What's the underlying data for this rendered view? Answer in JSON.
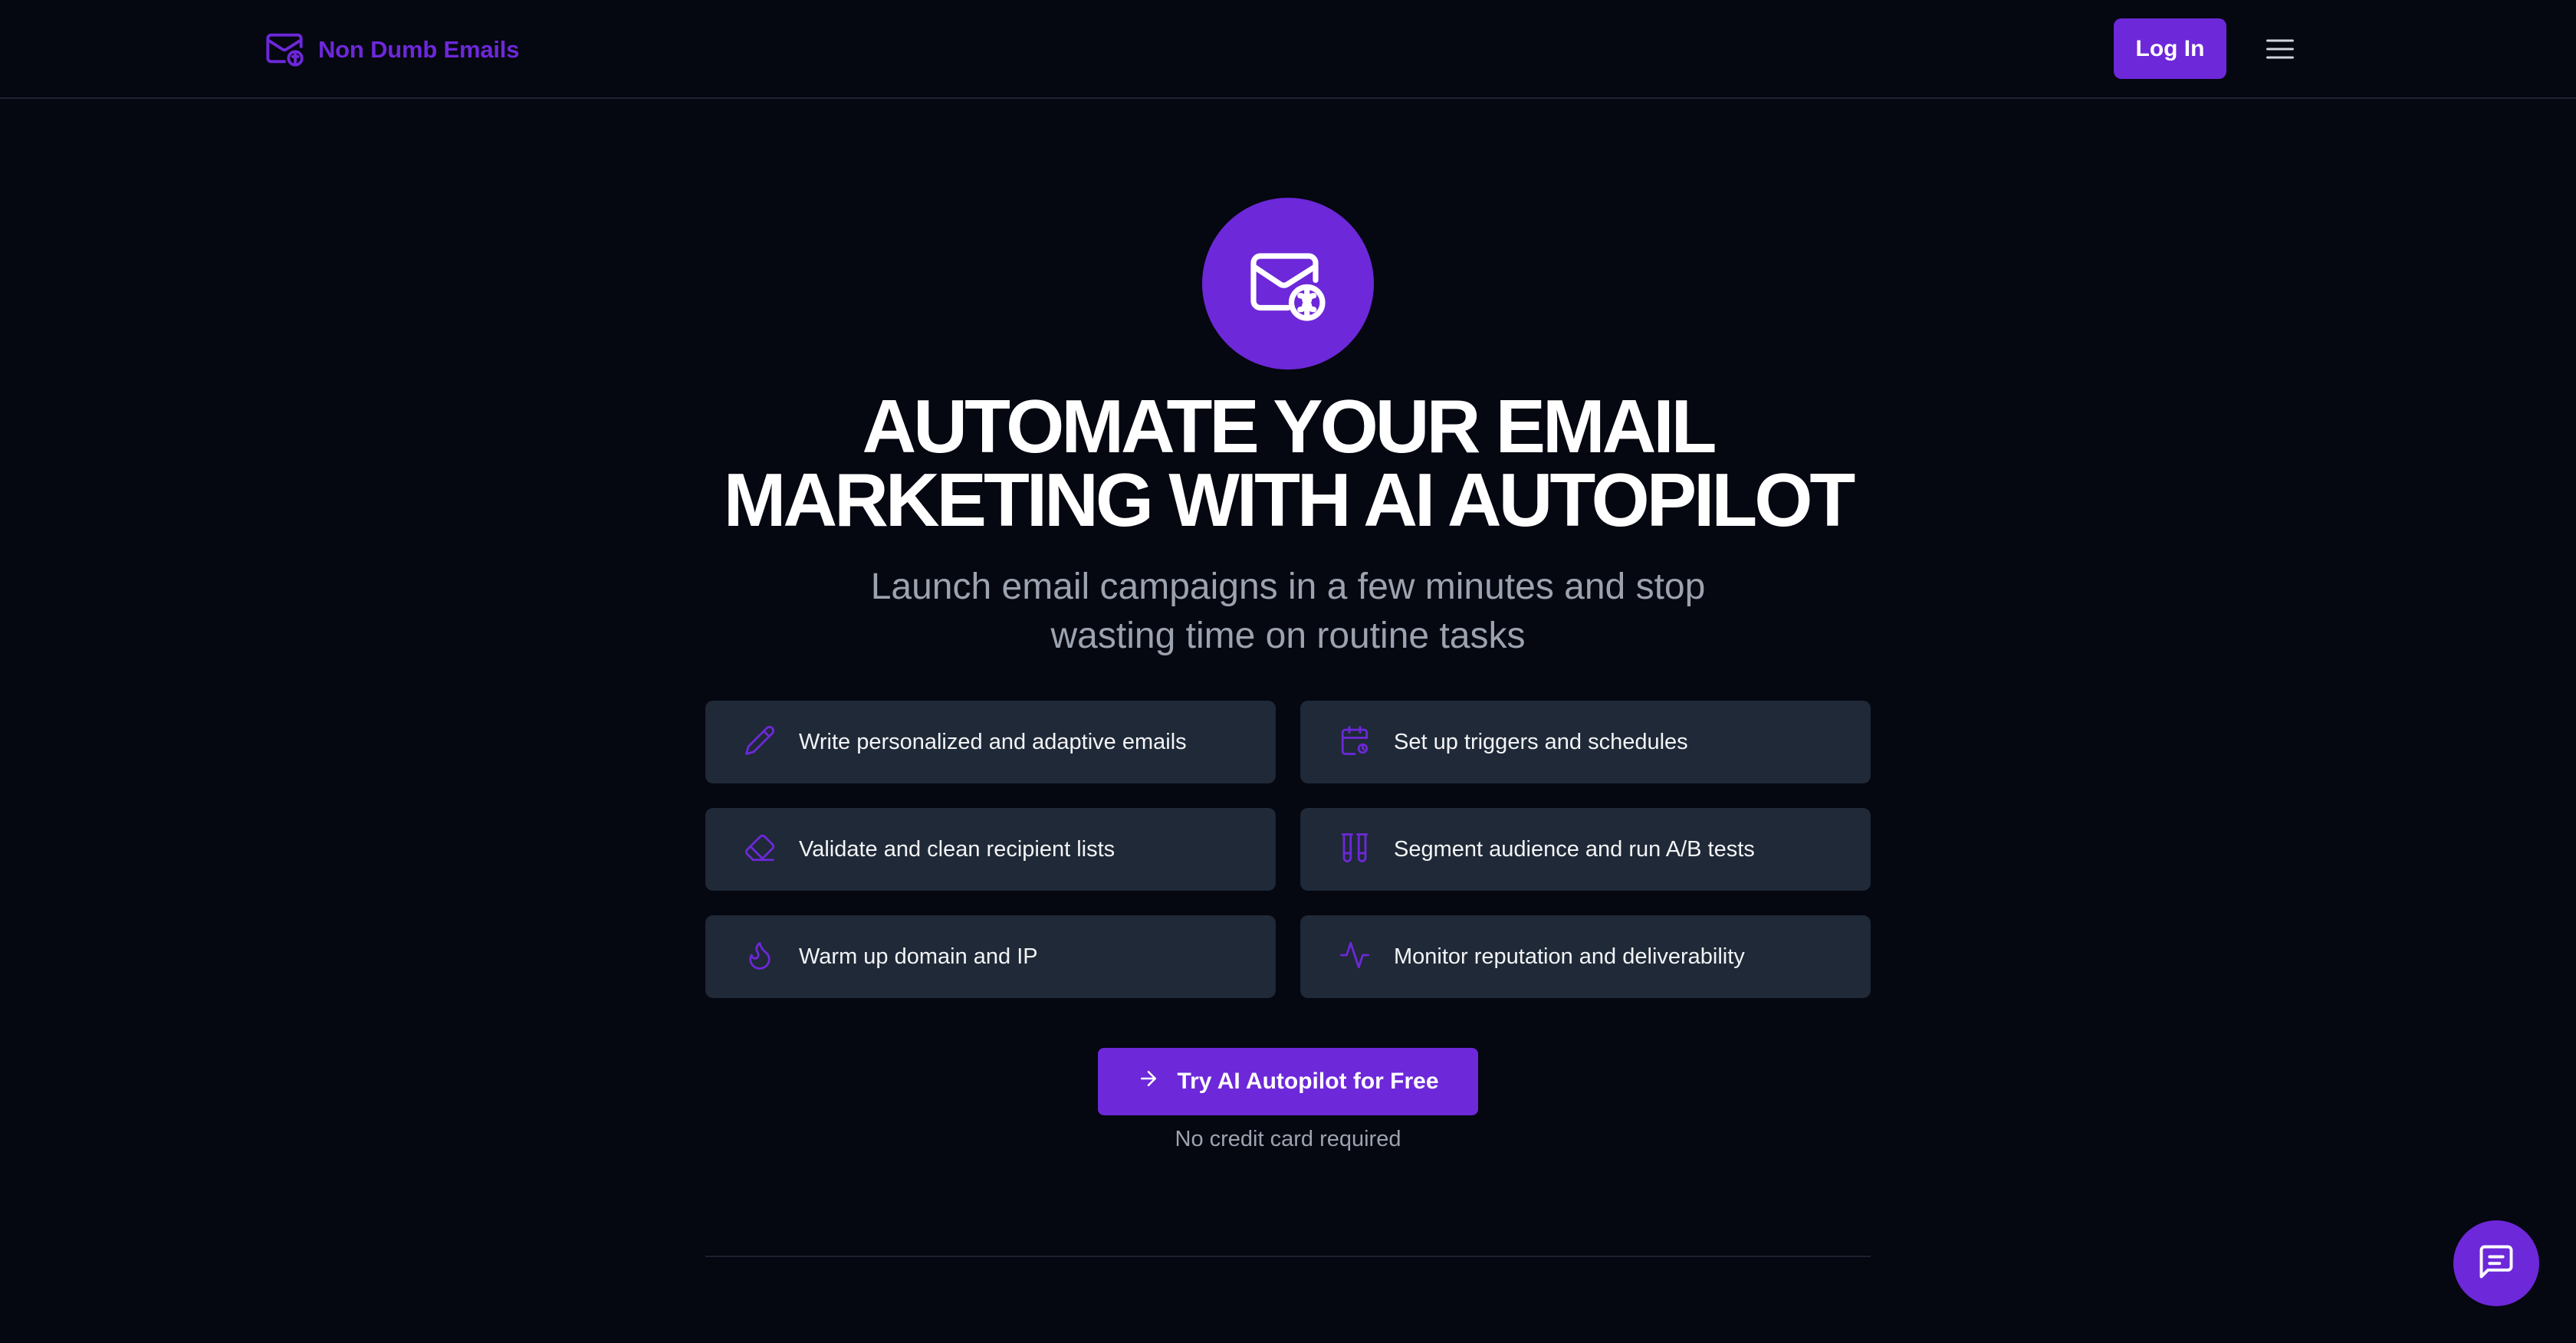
{
  "header": {
    "brand_name": "Non Dumb Emails",
    "brand_icon": "mail-brain-icon",
    "login_label": "Log In",
    "menu_icon": "hamburger-menu-icon"
  },
  "hero": {
    "icon": "mail-brain-icon",
    "title_line1": "AUTOMATE YOUR EMAIL",
    "title_line2": "MARKETING WITH AI AUTOPILOT",
    "subtitle_line1": "Launch email campaigns in a few minutes and stop",
    "subtitle_line2": "wasting time on routine tasks"
  },
  "features": [
    {
      "label": "Write personalized and adaptive emails",
      "icon": "pencil-icon"
    },
    {
      "label": "Set up triggers and schedules",
      "icon": "calendar-clock-icon"
    },
    {
      "label": "Validate and clean recipient lists",
      "icon": "eraser-icon"
    },
    {
      "label": "Segment audience and run A/B tests",
      "icon": "test-tubes-icon"
    },
    {
      "label": "Warm up domain and IP",
      "icon": "flame-icon"
    },
    {
      "label": "Monitor reputation and deliverability",
      "icon": "activity-icon"
    }
  ],
  "cta": {
    "label": "Try AI Autopilot for Free",
    "icon": "arrow-right-icon",
    "note": "No credit card required"
  },
  "chat": {
    "icon": "chat-message-icon"
  },
  "colors": {
    "background": "#050711",
    "accent": "#6d28d9",
    "card": "#1f2937",
    "muted_text": "#9ca3af"
  }
}
